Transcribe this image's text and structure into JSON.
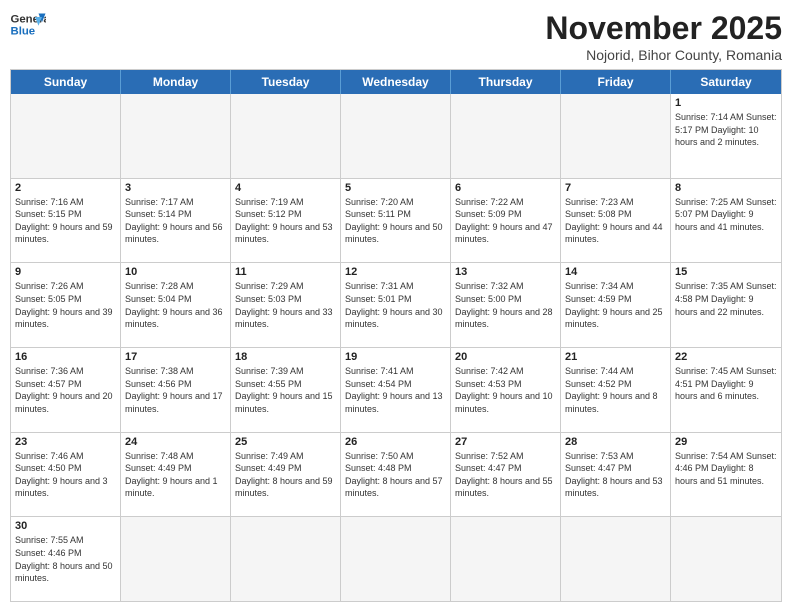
{
  "header": {
    "logo_general": "General",
    "logo_blue": "Blue",
    "month_title": "November 2025",
    "subtitle": "Nojorid, Bihor County, Romania"
  },
  "day_headers": [
    "Sunday",
    "Monday",
    "Tuesday",
    "Wednesday",
    "Thursday",
    "Friday",
    "Saturday"
  ],
  "weeks": [
    [
      {
        "num": "",
        "info": ""
      },
      {
        "num": "",
        "info": ""
      },
      {
        "num": "",
        "info": ""
      },
      {
        "num": "",
        "info": ""
      },
      {
        "num": "",
        "info": ""
      },
      {
        "num": "",
        "info": ""
      },
      {
        "num": "1",
        "info": "Sunrise: 7:14 AM\nSunset: 5:17 PM\nDaylight: 10 hours\nand 2 minutes."
      }
    ],
    [
      {
        "num": "2",
        "info": "Sunrise: 7:16 AM\nSunset: 5:15 PM\nDaylight: 9 hours\nand 59 minutes."
      },
      {
        "num": "3",
        "info": "Sunrise: 7:17 AM\nSunset: 5:14 PM\nDaylight: 9 hours\nand 56 minutes."
      },
      {
        "num": "4",
        "info": "Sunrise: 7:19 AM\nSunset: 5:12 PM\nDaylight: 9 hours\nand 53 minutes."
      },
      {
        "num": "5",
        "info": "Sunrise: 7:20 AM\nSunset: 5:11 PM\nDaylight: 9 hours\nand 50 minutes."
      },
      {
        "num": "6",
        "info": "Sunrise: 7:22 AM\nSunset: 5:09 PM\nDaylight: 9 hours\nand 47 minutes."
      },
      {
        "num": "7",
        "info": "Sunrise: 7:23 AM\nSunset: 5:08 PM\nDaylight: 9 hours\nand 44 minutes."
      },
      {
        "num": "8",
        "info": "Sunrise: 7:25 AM\nSunset: 5:07 PM\nDaylight: 9 hours\nand 41 minutes."
      }
    ],
    [
      {
        "num": "9",
        "info": "Sunrise: 7:26 AM\nSunset: 5:05 PM\nDaylight: 9 hours\nand 39 minutes."
      },
      {
        "num": "10",
        "info": "Sunrise: 7:28 AM\nSunset: 5:04 PM\nDaylight: 9 hours\nand 36 minutes."
      },
      {
        "num": "11",
        "info": "Sunrise: 7:29 AM\nSunset: 5:03 PM\nDaylight: 9 hours\nand 33 minutes."
      },
      {
        "num": "12",
        "info": "Sunrise: 7:31 AM\nSunset: 5:01 PM\nDaylight: 9 hours\nand 30 minutes."
      },
      {
        "num": "13",
        "info": "Sunrise: 7:32 AM\nSunset: 5:00 PM\nDaylight: 9 hours\nand 28 minutes."
      },
      {
        "num": "14",
        "info": "Sunrise: 7:34 AM\nSunset: 4:59 PM\nDaylight: 9 hours\nand 25 minutes."
      },
      {
        "num": "15",
        "info": "Sunrise: 7:35 AM\nSunset: 4:58 PM\nDaylight: 9 hours\nand 22 minutes."
      }
    ],
    [
      {
        "num": "16",
        "info": "Sunrise: 7:36 AM\nSunset: 4:57 PM\nDaylight: 9 hours\nand 20 minutes."
      },
      {
        "num": "17",
        "info": "Sunrise: 7:38 AM\nSunset: 4:56 PM\nDaylight: 9 hours\nand 17 minutes."
      },
      {
        "num": "18",
        "info": "Sunrise: 7:39 AM\nSunset: 4:55 PM\nDaylight: 9 hours\nand 15 minutes."
      },
      {
        "num": "19",
        "info": "Sunrise: 7:41 AM\nSunset: 4:54 PM\nDaylight: 9 hours\nand 13 minutes."
      },
      {
        "num": "20",
        "info": "Sunrise: 7:42 AM\nSunset: 4:53 PM\nDaylight: 9 hours\nand 10 minutes."
      },
      {
        "num": "21",
        "info": "Sunrise: 7:44 AM\nSunset: 4:52 PM\nDaylight: 9 hours\nand 8 minutes."
      },
      {
        "num": "22",
        "info": "Sunrise: 7:45 AM\nSunset: 4:51 PM\nDaylight: 9 hours\nand 6 minutes."
      }
    ],
    [
      {
        "num": "23",
        "info": "Sunrise: 7:46 AM\nSunset: 4:50 PM\nDaylight: 9 hours\nand 3 minutes."
      },
      {
        "num": "24",
        "info": "Sunrise: 7:48 AM\nSunset: 4:49 PM\nDaylight: 9 hours\nand 1 minute."
      },
      {
        "num": "25",
        "info": "Sunrise: 7:49 AM\nSunset: 4:49 PM\nDaylight: 8 hours\nand 59 minutes."
      },
      {
        "num": "26",
        "info": "Sunrise: 7:50 AM\nSunset: 4:48 PM\nDaylight: 8 hours\nand 57 minutes."
      },
      {
        "num": "27",
        "info": "Sunrise: 7:52 AM\nSunset: 4:47 PM\nDaylight: 8 hours\nand 55 minutes."
      },
      {
        "num": "28",
        "info": "Sunrise: 7:53 AM\nSunset: 4:47 PM\nDaylight: 8 hours\nand 53 minutes."
      },
      {
        "num": "29",
        "info": "Sunrise: 7:54 AM\nSunset: 4:46 PM\nDaylight: 8 hours\nand 51 minutes."
      }
    ],
    [
      {
        "num": "30",
        "info": "Sunrise: 7:55 AM\nSunset: 4:46 PM\nDaylight: 8 hours\nand 50 minutes."
      },
      {
        "num": "",
        "info": ""
      },
      {
        "num": "",
        "info": ""
      },
      {
        "num": "",
        "info": ""
      },
      {
        "num": "",
        "info": ""
      },
      {
        "num": "",
        "info": ""
      },
      {
        "num": "",
        "info": ""
      }
    ]
  ]
}
